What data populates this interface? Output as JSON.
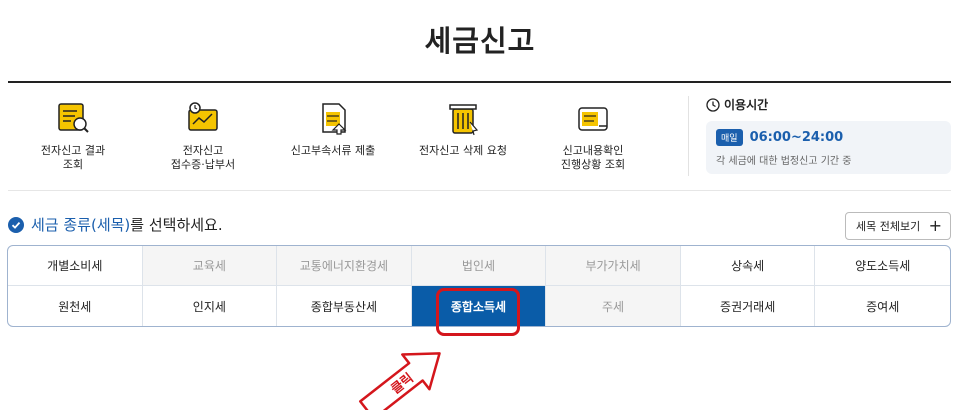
{
  "page": {
    "title": "세금신고"
  },
  "quick_menu": [
    {
      "label": "전자신고 결과\n조회",
      "icon": "report-search-icon"
    },
    {
      "label": "전자신고\n접수증·납부서",
      "icon": "receipt-clock-icon"
    },
    {
      "label": "신고부속서류 제출",
      "icon": "document-upload-icon"
    },
    {
      "label": "전자신고 삭제 요청",
      "icon": "trash-icon"
    },
    {
      "label": "신고내용확인\n진행상황 조회",
      "icon": "progress-check-icon"
    }
  ],
  "hours": {
    "title": "이용시간",
    "badge": "매일",
    "time": "06:00~24:00",
    "note": "각 세금에 대한 법정신고 기간 중"
  },
  "select": {
    "prefix": "세금 종류(세목)",
    "suffix": "를 선택하세요.",
    "view_all": "세목 전체보기",
    "view_all_icon": "+"
  },
  "tax_types": [
    {
      "label": "개별소비세",
      "state": "enabled"
    },
    {
      "label": "교육세",
      "state": "disabled"
    },
    {
      "label": "교통에너지환경세",
      "state": "disabled"
    },
    {
      "label": "법인세",
      "state": "disabled"
    },
    {
      "label": "부가가치세",
      "state": "disabled"
    },
    {
      "label": "상속세",
      "state": "enabled"
    },
    {
      "label": "양도소득세",
      "state": "enabled"
    },
    {
      "label": "원천세",
      "state": "enabled"
    },
    {
      "label": "인지세",
      "state": "enabled"
    },
    {
      "label": "종합부동산세",
      "state": "enabled"
    },
    {
      "label": "종합소득세",
      "state": "selected"
    },
    {
      "label": "주세",
      "state": "disabled"
    },
    {
      "label": "증권거래세",
      "state": "enabled"
    },
    {
      "label": "증여세",
      "state": "enabled"
    }
  ],
  "annotation": {
    "text": "클릭"
  },
  "colors": {
    "accent": "#0a5ca8",
    "highlight": "#d4161c",
    "icon_yellow": "#f5c400"
  }
}
